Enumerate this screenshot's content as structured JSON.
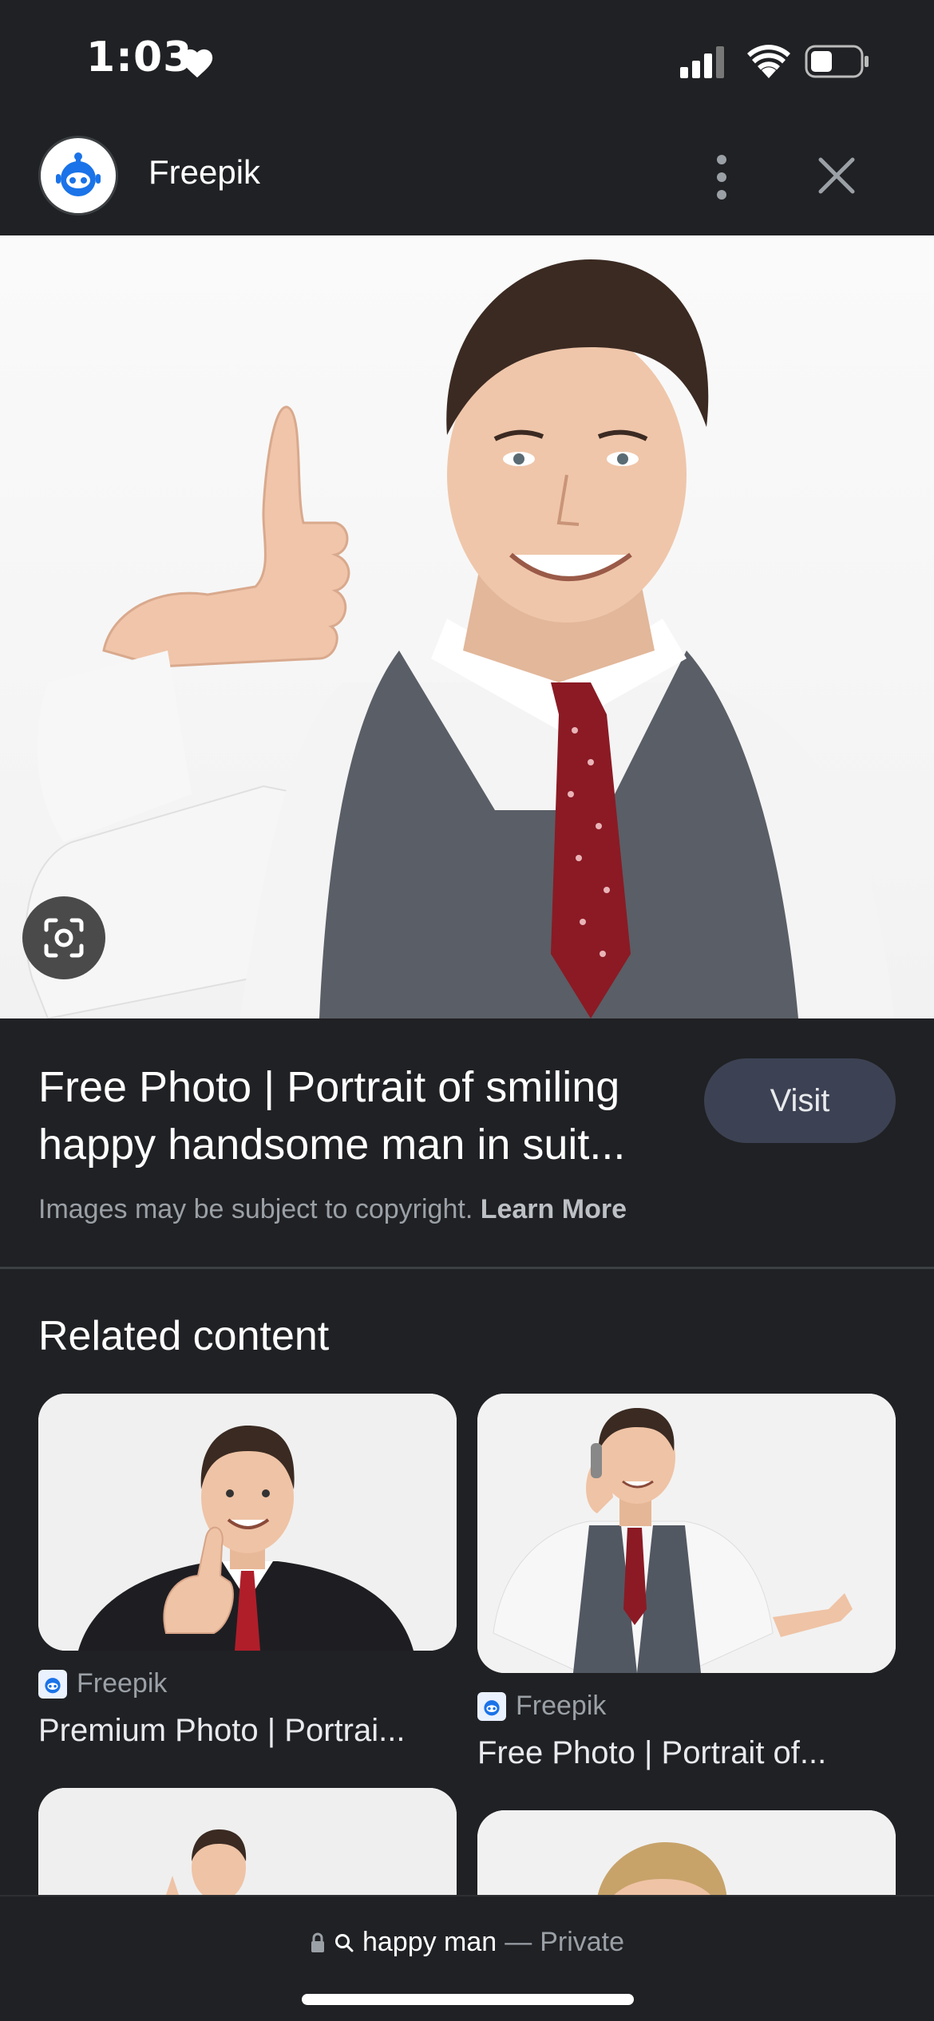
{
  "status_bar": {
    "time": "1:03",
    "heart_icon": "heart-icon",
    "signal_icon": "cellular-signal-icon",
    "wifi_icon": "wifi-icon",
    "battery_icon": "battery-icon"
  },
  "header": {
    "source_name": "Freepik",
    "logo_icon": "freepik-logo-icon",
    "more_icon": "more-vertical-icon",
    "close_icon": "close-icon"
  },
  "main_image": {
    "lens_icon": "google-lens-icon"
  },
  "result": {
    "title": "Free Photo | Portrait of smiling happy handsome man in suit...",
    "visit_label": "Visit",
    "copyright_text": "Images may be subject to copyright.",
    "learn_more_label": "Learn More"
  },
  "related": {
    "heading": "Related content",
    "cards": [
      {
        "source": "Freepik",
        "title": "Premium Photo | Portrai..."
      },
      {
        "source": "Freepik",
        "title": "Free Photo | Portrait of..."
      }
    ]
  },
  "bottom_bar": {
    "query": "happy man",
    "separator": "—",
    "mode": "Private",
    "lock_icon": "lock-icon",
    "search_icon": "search-icon"
  },
  "colors": {
    "background": "#202124",
    "visit_button": "#3c4253",
    "secondary_text": "#9aa0a6",
    "logo_blue": "#1a73e8"
  }
}
